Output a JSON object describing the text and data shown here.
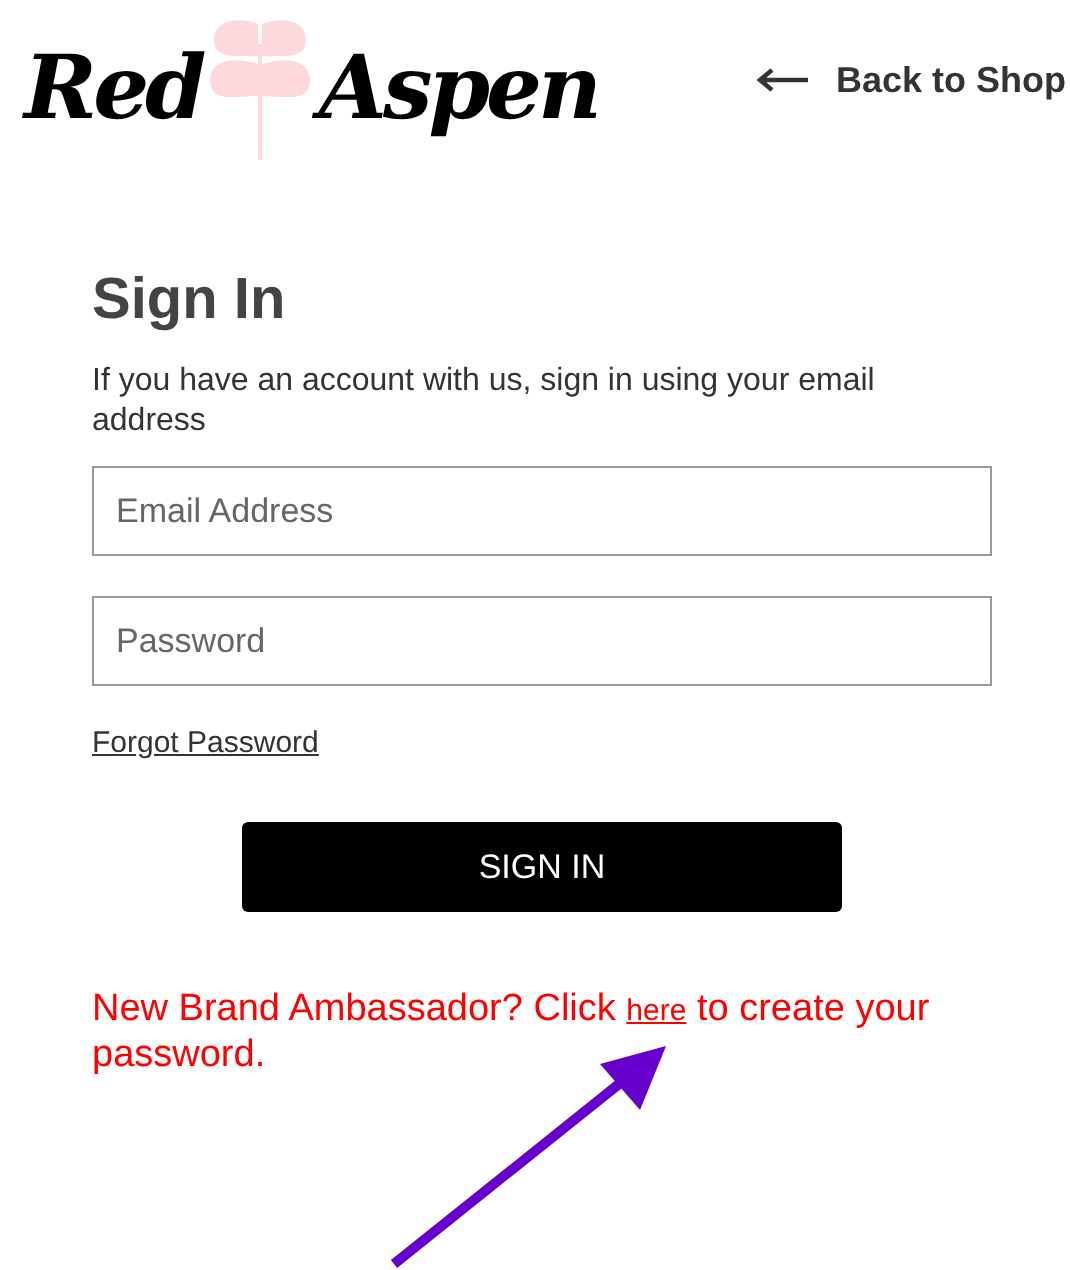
{
  "header": {
    "logo": {
      "first": "Red",
      "second": "Aspen"
    },
    "back_link": {
      "label": "Back to Shop"
    }
  },
  "form": {
    "title": "Sign In",
    "intro": "If you have an account with us, sign in using your email address",
    "fields": [
      {
        "placeholder": "Email Address"
      },
      {
        "placeholder": "Password"
      }
    ],
    "forgot_link": "Forgot Password",
    "submit": "SIGN IN"
  },
  "ambassador_note": {
    "before": "New Brand Ambassador? Click",
    "link": "here",
    "after": "to create your password."
  },
  "annotation": {
    "kind": "arrow"
  }
}
